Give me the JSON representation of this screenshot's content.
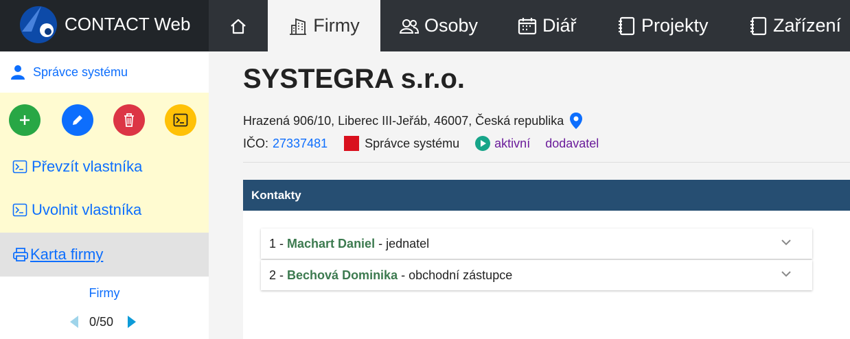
{
  "app": {
    "title": "CONTACT Web"
  },
  "nav": {
    "home_icon": "home-icon",
    "items": [
      {
        "label": "Firmy",
        "icon": "building-icon"
      },
      {
        "label": "Osoby",
        "icon": "people-icon"
      },
      {
        "label": "Diář",
        "icon": "calendar-icon"
      },
      {
        "label": "Projekty",
        "icon": "notebook-icon"
      },
      {
        "label": "Zařízení",
        "icon": "notebook-icon"
      }
    ]
  },
  "sidebar": {
    "user": "Správce systému",
    "actions": [
      {
        "name": "add",
        "color": "#28a745"
      },
      {
        "name": "edit",
        "color": "#0d6efd"
      },
      {
        "name": "delete",
        "color": "#dc3545"
      },
      {
        "name": "terminal",
        "color": "#ffc107"
      }
    ],
    "links": [
      "Převzít vlastníka",
      "Uvolnit vlastníka"
    ],
    "card": "Karta firmy",
    "pager": {
      "label": "Firmy",
      "position": "0/50"
    }
  },
  "company": {
    "name": "SYSTEGRA s.r.o.",
    "address": "Hrazená 906/10, Liberec III-Jeřáb, 46007, Česká republika",
    "ico_label": "IČO:",
    "ico": "27337481",
    "owner": "Správce systému",
    "status": "aktivní",
    "type": "dodavatel"
  },
  "contacts": {
    "header": "Kontakty",
    "items": [
      {
        "index": "1 -",
        "name": "Machart Daniel",
        "role": "- jednatel"
      },
      {
        "index": "2 -",
        "name": "Bechová Dominika",
        "role": "- obchodní zástupce"
      }
    ]
  }
}
